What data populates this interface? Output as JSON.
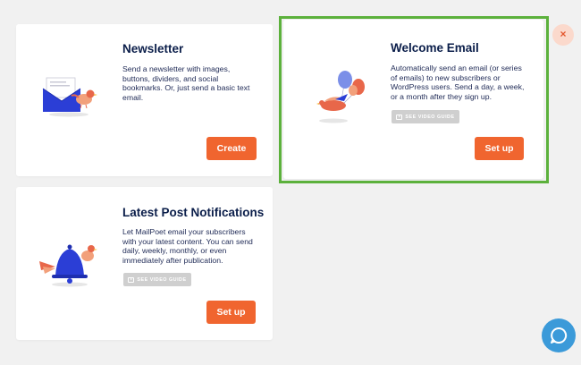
{
  "cards": {
    "newsletter": {
      "title": "Newsletter",
      "description": "Send a newsletter with images, buttons, dividers, and social bookmarks. Or, just send a basic text email.",
      "button_label": "Create"
    },
    "welcome": {
      "title": "Welcome Email",
      "description": "Automatically send an email (or series of emails) to new subscribers or WordPress users. Send a day, a week, or a month after they sign up.",
      "video_guide_label": "SEE VIDEO GUIDE",
      "button_label": "Set up"
    },
    "post_notifications": {
      "title": "Latest Post Notifications",
      "description": "Let MailPoet email your subscribers with your latest content. You can send daily, weekly, monthly, or even immediately after publication.",
      "video_guide_label": "SEE VIDEO GUIDE",
      "button_label": "Set up"
    }
  },
  "close_label": "×",
  "colors": {
    "accent": "#f0652f",
    "highlight": "#5cb13c",
    "help": "#3b9ad9",
    "title": "#0b1e4a"
  },
  "icons": {
    "close": "close-icon",
    "help": "chat-bubble-icon",
    "video": "video-icon"
  }
}
